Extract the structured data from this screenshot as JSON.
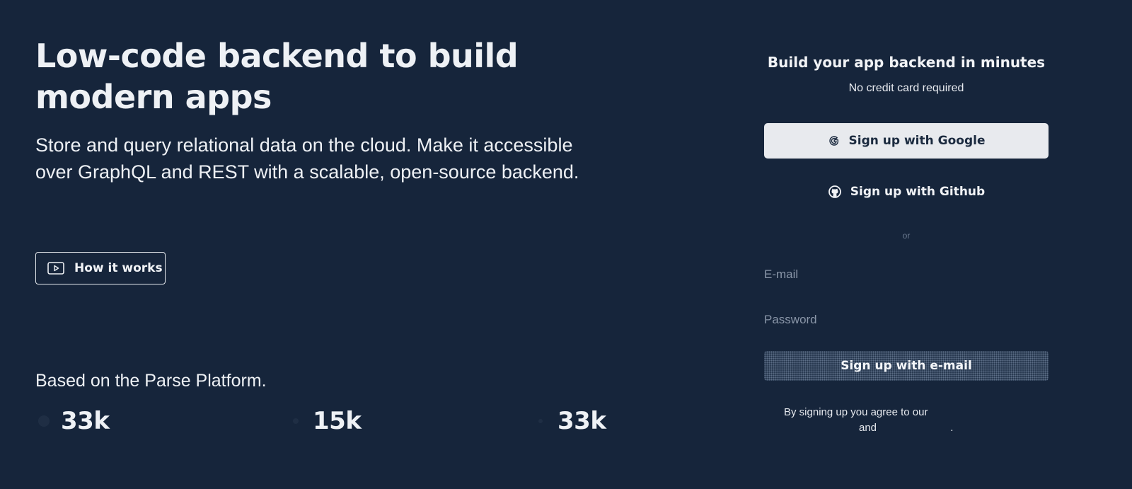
{
  "hero": {
    "title": "Low-code backend to build modern apps",
    "subtitle": "Store and query relational data on the cloud. Make it accessible over GraphQL and REST with a scalable, open-source backend.",
    "how_it_works_label": "How it works",
    "how_it_works_icon": "play-icon"
  },
  "platform": {
    "based_on": "Based on the Parse Platform.",
    "stats": [
      {
        "icon": "stat-icon",
        "value": "33k"
      },
      {
        "icon": "stat-icon",
        "value": "15k"
      },
      {
        "icon": "stat-icon",
        "value": "33k"
      }
    ]
  },
  "signup": {
    "title": "Build your app backend in minutes",
    "subtitle": "No credit card required",
    "google_label": "Sign up with Google",
    "google_icon": "google-icon",
    "github_label": "Sign up with Github",
    "github_icon": "github-icon",
    "or_label": "or",
    "email_placeholder": "E-mail",
    "password_placeholder": "Password",
    "email_button_label": "Sign up with e-mail",
    "legal_line1": "By signing up you agree to our",
    "legal_and": "and",
    "legal_period": "."
  },
  "colors": {
    "background": "#16253b",
    "text": "#eef1f5",
    "google_button_bg": "#e8eaee"
  }
}
